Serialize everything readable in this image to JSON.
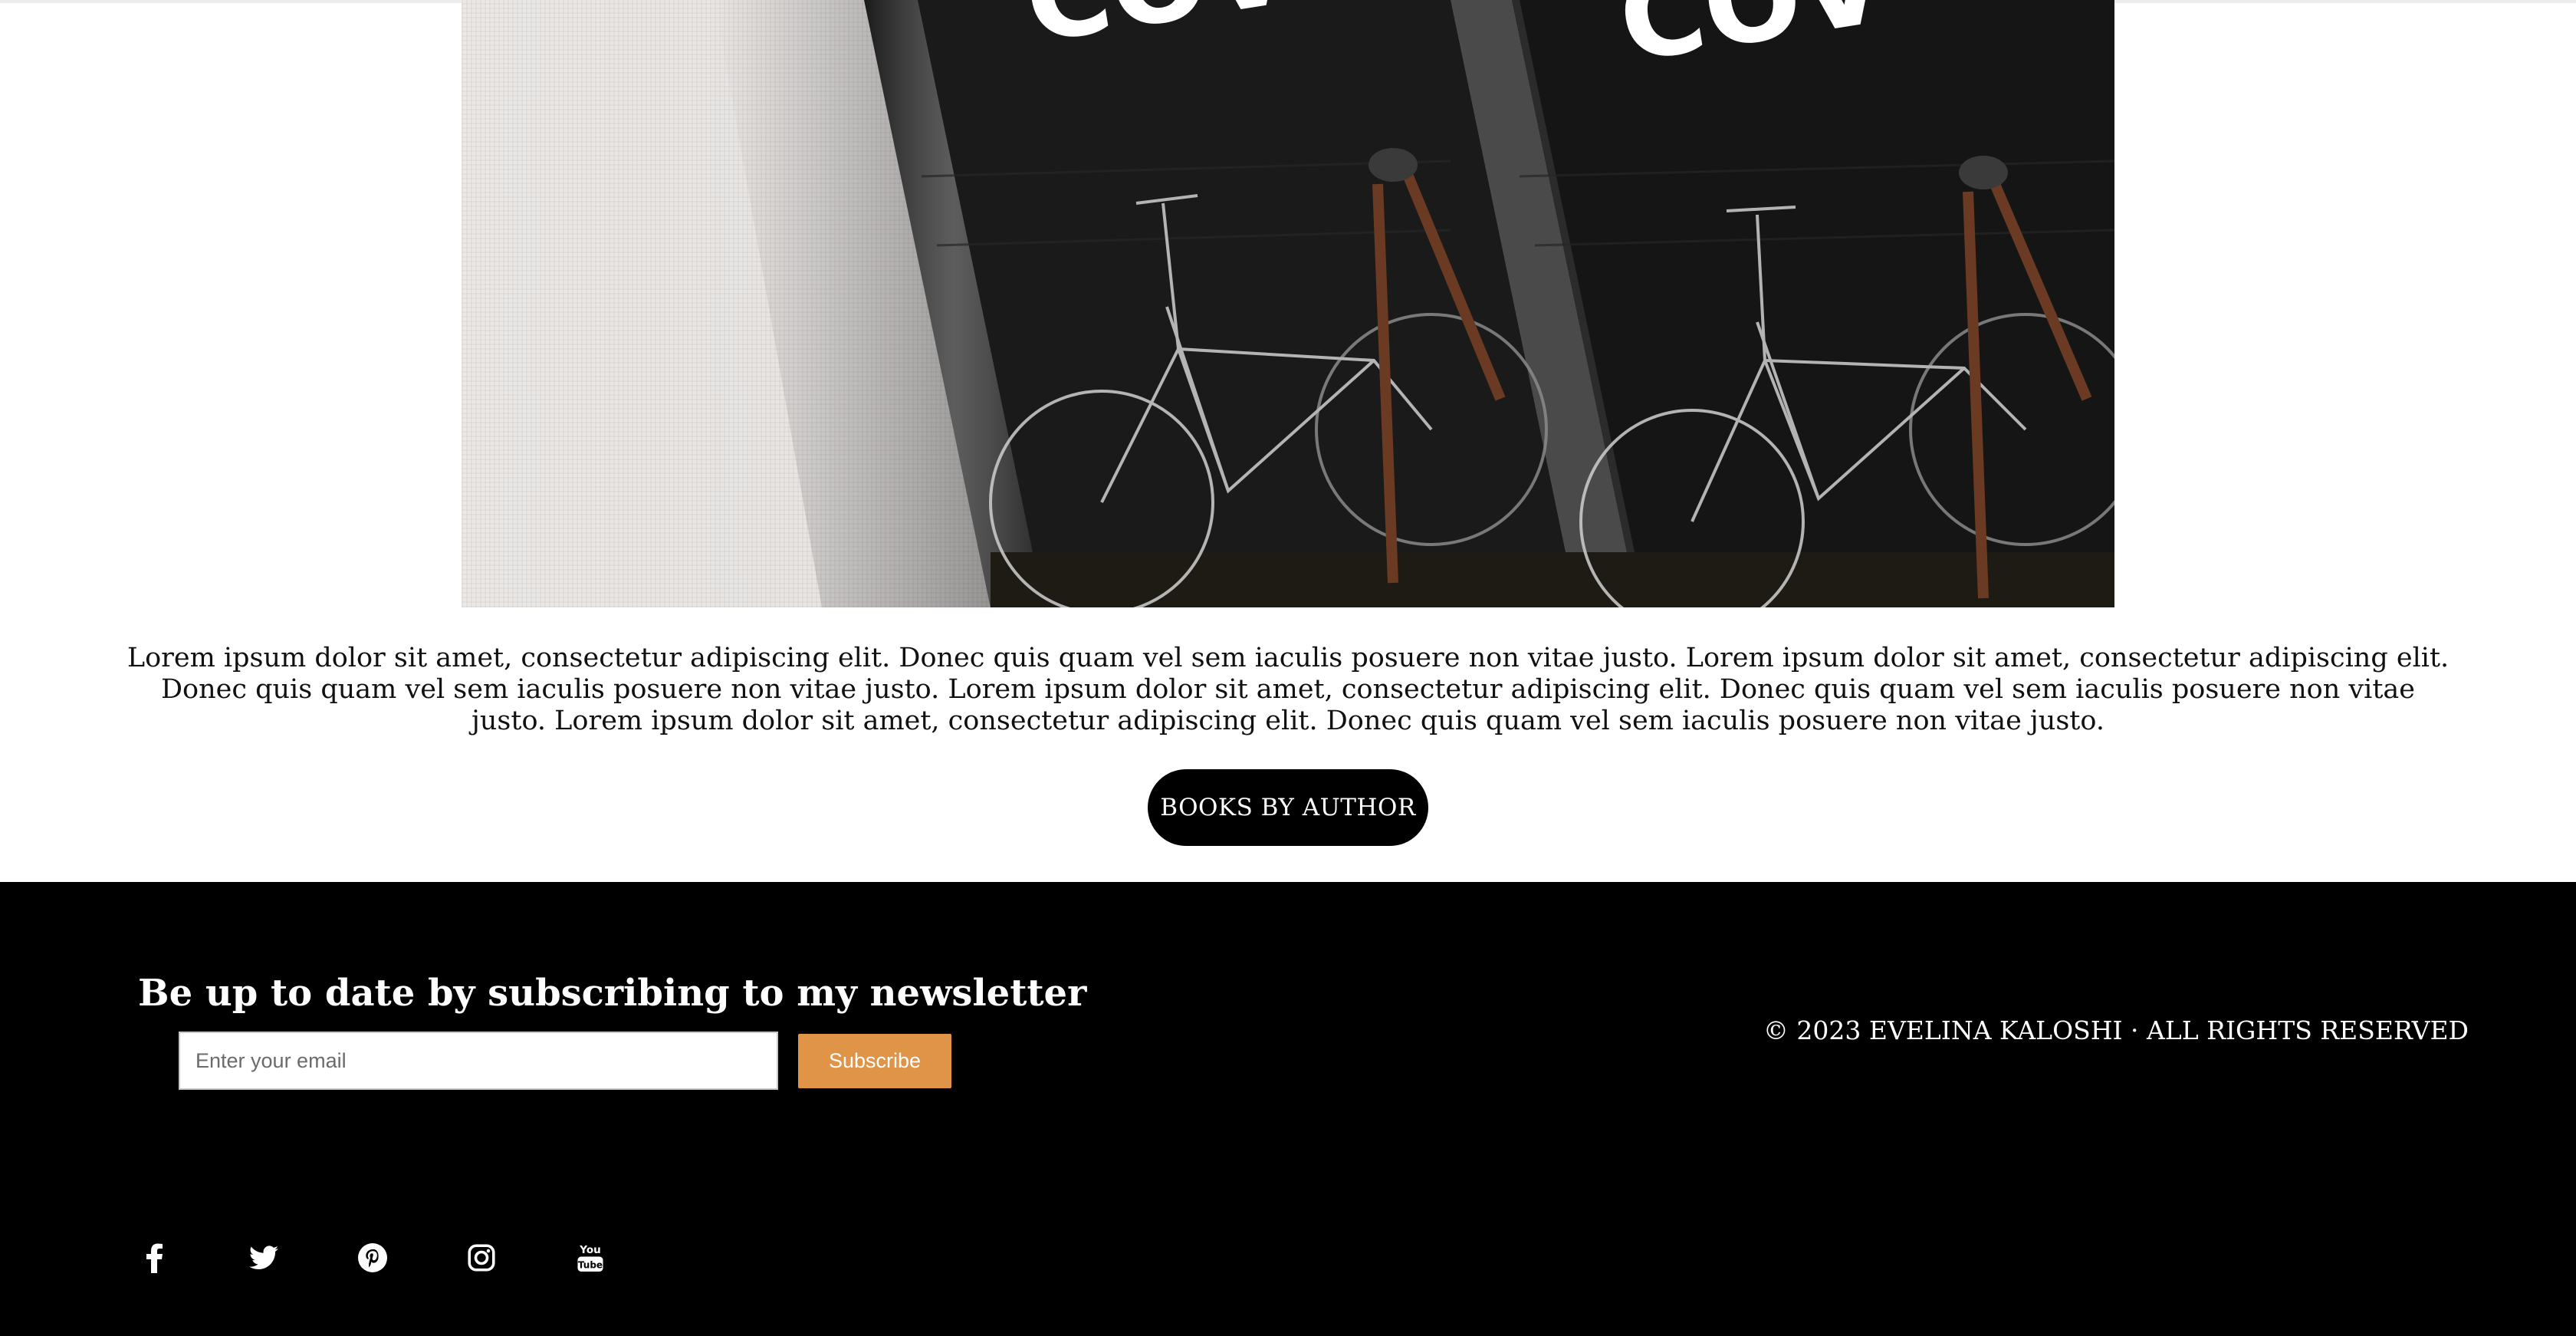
{
  "hero": {
    "cover_text": "COV"
  },
  "description": "Lorem ipsum dolor sit amet, consectetur adipiscing elit. Donec quis quam vel sem iaculis posuere non vitae justo. Lorem ipsum dolor sit amet, consectetur adipiscing elit. Donec quis quam vel sem iaculis posuere non vitae justo. Lorem ipsum dolor sit amet, consectetur adipiscing elit. Donec quis quam vel sem iaculis posuere non vitae justo. Lorem ipsum dolor sit amet, consectetur adipiscing elit. Donec quis quam vel sem iaculis posuere non vitae justo.",
  "cta": {
    "label": "BOOKS BY AUTHOR"
  },
  "footer": {
    "newsletter_title": "Be up to date by subscribing to my newsletter",
    "email_placeholder": "Enter your email",
    "email_value": "",
    "subscribe_label": "Subscribe",
    "copyright": "© 2023 EVELINA KALOSHI · ALL RIGHTS RESERVED",
    "subscribe_color": "#e09448",
    "social": [
      {
        "icon": "facebook-icon"
      },
      {
        "icon": "twitter-icon"
      },
      {
        "icon": "pinterest-icon"
      },
      {
        "icon": "instagram-icon"
      },
      {
        "icon": "youtube-icon"
      }
    ]
  }
}
